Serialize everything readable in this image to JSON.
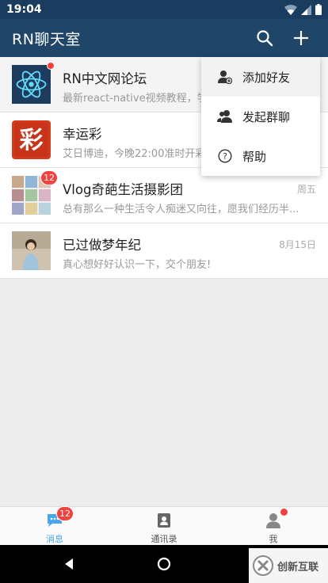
{
  "status_bar": {
    "time": "19:04"
  },
  "header": {
    "title": "RN聊天室",
    "search_icon": "search-icon",
    "add_icon": "plus-icon"
  },
  "chats": [
    {
      "title": "RN中文网论坛",
      "preview": "最新react-native视频教程，学习最新...",
      "time": "",
      "badge": "",
      "dot": true,
      "avatar": "react-logo"
    },
    {
      "title": "幸运彩",
      "preview": "艾日博迪，今晚22:00准时开彩...",
      "time": "",
      "badge": "",
      "dot": false,
      "avatar": "lottery-logo"
    },
    {
      "title": "Vlog奇葩生活摄影团",
      "preview": "总有那么一种生活令人痴迷又向往，愿我们经历半...",
      "time": "周五",
      "badge": "12",
      "dot": false,
      "avatar": "group-collage"
    },
    {
      "title": "已过做梦年纪",
      "preview": "真心想好好认识一下，交个朋友!",
      "time": "8月15日",
      "badge": "",
      "dot": false,
      "avatar": "user-photo"
    }
  ],
  "dropdown": {
    "items": [
      {
        "label": "添加好友",
        "icon": "add-friend-icon"
      },
      {
        "label": "发起群聊",
        "icon": "group-chat-icon"
      },
      {
        "label": "帮助",
        "icon": "help-icon"
      }
    ]
  },
  "tabs": [
    {
      "label": "消息",
      "icon": "message-icon",
      "badge": "12"
    },
    {
      "label": "通讯录",
      "icon": "contacts-icon",
      "badge": ""
    },
    {
      "label": "我",
      "icon": "person-icon",
      "badge": ""
    }
  ],
  "watermark": {
    "text": "创新互联"
  },
  "colors": {
    "header": "#1f4668",
    "status_bar": "#1a3c5f",
    "badge": "#f1423d",
    "active_tab": "#4aa6e8"
  }
}
